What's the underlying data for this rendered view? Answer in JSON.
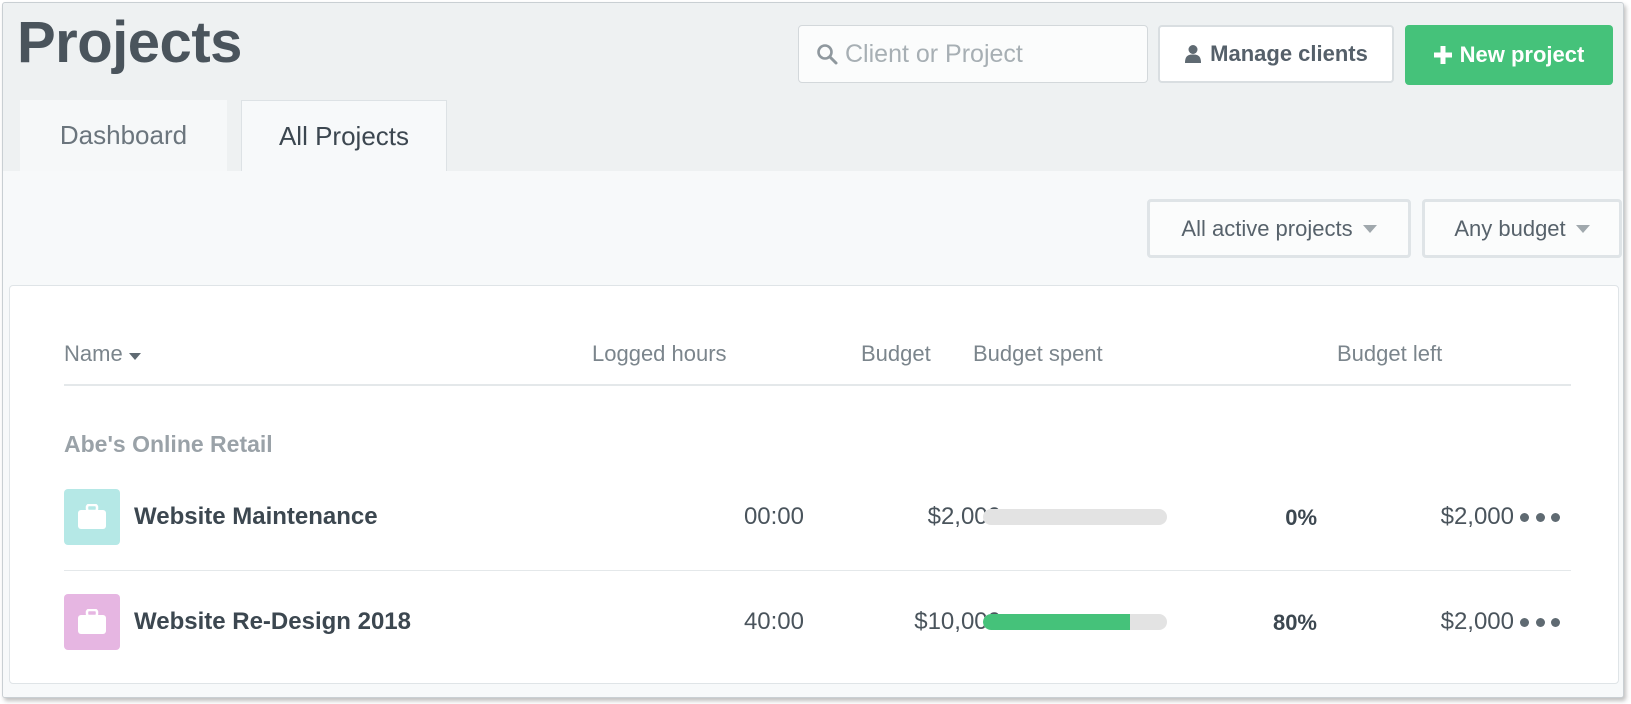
{
  "header": {
    "title": "Projects",
    "search_placeholder": "Client or Project",
    "manage_clients_label": "Manage clients",
    "new_project_label": "New project"
  },
  "tabs": [
    {
      "label": "Dashboard",
      "active": false
    },
    {
      "label": "All Projects",
      "active": true
    }
  ],
  "filters": {
    "status": "All active projects",
    "budget": "Any budget"
  },
  "table": {
    "columns": [
      "Name",
      "Logged hours",
      "Budget",
      "Budget spent",
      "Budget left"
    ],
    "sort_column": "Name",
    "groups": [
      {
        "client": "Abe's Online Retail",
        "projects": [
          {
            "name": "Website Maintenance",
            "icon": "briefcase-icon",
            "icon_color": "#b5e8e6",
            "logged_hours": "00:00",
            "budget": "$2,000",
            "spent_fraction": 0,
            "spent_label": "0%",
            "budget_left": "$2,000"
          },
          {
            "name": "Website Re-Design 2018",
            "icon": "briefcase-icon",
            "icon_color": "#e6b6e2",
            "logged_hours": "40:00",
            "budget": "$10,000",
            "spent_fraction": 0.8,
            "spent_label": "80%",
            "budget_left": "$2,000"
          }
        ]
      }
    ]
  },
  "colors": {
    "accent_green": "#45c27a",
    "background": "#eef1f2"
  }
}
